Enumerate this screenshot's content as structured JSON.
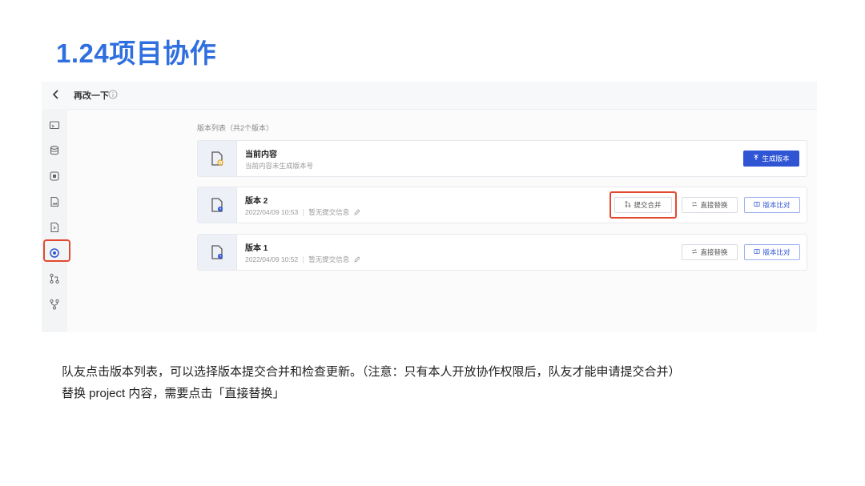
{
  "slide": {
    "title": "1.24项目协作",
    "caption_line1": "队友点击版本列表，可以选择版本提交合并和检查更新。（注意：只有本人开放协作权限后，队友才能申请提交合并）",
    "caption_line2": "替换 project 内容，需要点击「直接替换」"
  },
  "app": {
    "project_name": "再改一下",
    "list_header": "版本列表（共2个版本）",
    "current": {
      "title": "当前内容",
      "subtitle": "当前内容未生成版本号",
      "generate_label": "生成版本"
    },
    "versions": [
      {
        "title": "版本 2",
        "time": "2022/04/09 10:53",
        "note": "暂无提交信息",
        "merge_label": "提交合并",
        "replace_label": "直接替换",
        "compare_label": "版本比对"
      },
      {
        "title": "版本 1",
        "time": "2022/04/09 10:52",
        "note": "暂无提交信息",
        "replace_label": "直接替换",
        "compare_label": "版本比对"
      }
    ],
    "sidebar_icons": [
      "folder-icon",
      "database-icon",
      "component-icon",
      "image-file-icon",
      "code-file-icon",
      "version-history-icon",
      "merge-request-icon",
      "branch-icon"
    ]
  },
  "colors": {
    "title_blue": "#2f6fe0",
    "primary": "#2f55d4",
    "highlight": "#e2492f"
  }
}
